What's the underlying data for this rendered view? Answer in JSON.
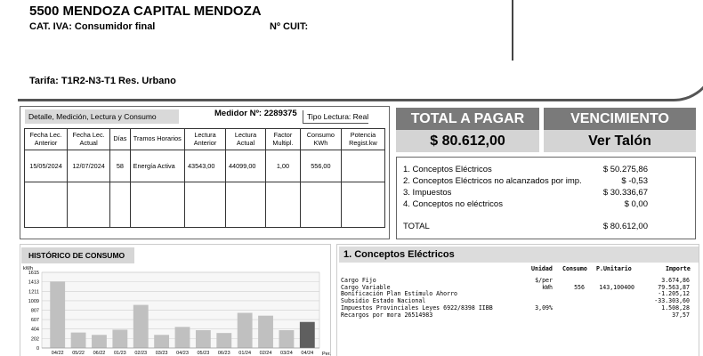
{
  "header": {
    "address": "5500 MENDOZA CAPITAL MENDOZA",
    "cat_iva": "CAT. IVA: Consumidor final",
    "cuit_label": "Nº CUIT:",
    "tarifa": "Tarifa:  T1R2-N3-T1 Res. Urbano"
  },
  "detail": {
    "tab_label": "Detalle, Medición, Lectura y Consumo",
    "medidor": "Medidor Nº: 2289375",
    "tipo_lectura": "Tipo Lectura: Real",
    "columns": [
      "Fecha Lec. Anterior",
      "Fecha Lec. Actual",
      "Días",
      "Tramos Horarios",
      "Lectura Anterior",
      "Lectura Actual",
      "Factor Multipl.",
      "Consumo KWh",
      "Potencia Regist.kw"
    ],
    "row": [
      "15/05/2024",
      "12/07/2024",
      "58",
      "Energía Activa",
      "43543,00",
      "44099,00",
      "1,00",
      "556,00",
      ""
    ]
  },
  "totals": {
    "total_label": "TOTAL A PAGAR",
    "total_amount": "$ 80.612,00",
    "venc_label": "VENCIMIENTO",
    "venc_value": "Ver Talón",
    "items": [
      {
        "label": "1. Conceptos Eléctricos",
        "amount": "$ 50.275,86"
      },
      {
        "label": "2. Conceptos Eléctricos no alcanzados por imp.",
        "amount": "$ -0,53"
      },
      {
        "label": "3. Impuestos",
        "amount": "$ 30.336,67"
      },
      {
        "label": "4. Conceptos no eléctricos",
        "amount": "$ 0,00"
      }
    ],
    "total_row_label": "TOTAL",
    "total_row_amount": "$ 80.612,00"
  },
  "historico": {
    "tab_label": "HISTÓRICO DE CONSUMO",
    "unit": "kWh",
    "period_suffix": "Per."
  },
  "chart_data": {
    "type": "bar",
    "title": "HISTÓRICO DE CONSUMO",
    "ylabel": "kWh",
    "xlabel": "Per.",
    "yticks": [
      0,
      202,
      404,
      607,
      807,
      1009,
      1211,
      1413,
      1615
    ],
    "ylim": [
      0,
      1615
    ],
    "categories": [
      "04/22",
      "05/22",
      "06/22",
      "01/23",
      "02/23",
      "03/23",
      "04/23",
      "05/23",
      "06/23",
      "01/24",
      "02/24",
      "03/24",
      "04/24"
    ],
    "values": [
      1420,
      330,
      280,
      390,
      920,
      280,
      450,
      380,
      320,
      750,
      690,
      380,
      556
    ],
    "highlight_index": 12,
    "colors": {
      "bar": "#c0c0c0",
      "highlight": "#5f5f5f"
    }
  },
  "conceptos": {
    "tab_label": "1. Conceptos Eléctricos",
    "headers": {
      "unidad": "Unidad",
      "consumo": "Consumo",
      "punit": "P.Unitario",
      "importe": "Importe"
    },
    "rows": [
      {
        "desc": "Cargo Fijo",
        "unidad": "$/per",
        "consumo": "",
        "punit": "",
        "importe": "3.674,86"
      },
      {
        "desc": "Cargo Variable",
        "unidad": "kWh",
        "consumo": "556",
        "punit": "143,100400",
        "importe": "79.563,87"
      },
      {
        "desc": "Bonificación Plan Estímulo Ahorro",
        "unidad": "",
        "consumo": "",
        "punit": "",
        "importe": "-1.205,12"
      },
      {
        "desc": "Subsidio Estado Nacional",
        "unidad": "",
        "consumo": "",
        "punit": "",
        "importe": "-33.303,60"
      },
      {
        "desc": "Impuestos Provinciales Leyes 6922/8398 IIBB",
        "unidad": "3,09%",
        "consumo": "",
        "punit": "",
        "importe": "1.508,28"
      },
      {
        "desc": "Recargos por mora 26514983",
        "unidad": "",
        "consumo": "",
        "punit": "",
        "importe": "37,57"
      }
    ]
  }
}
